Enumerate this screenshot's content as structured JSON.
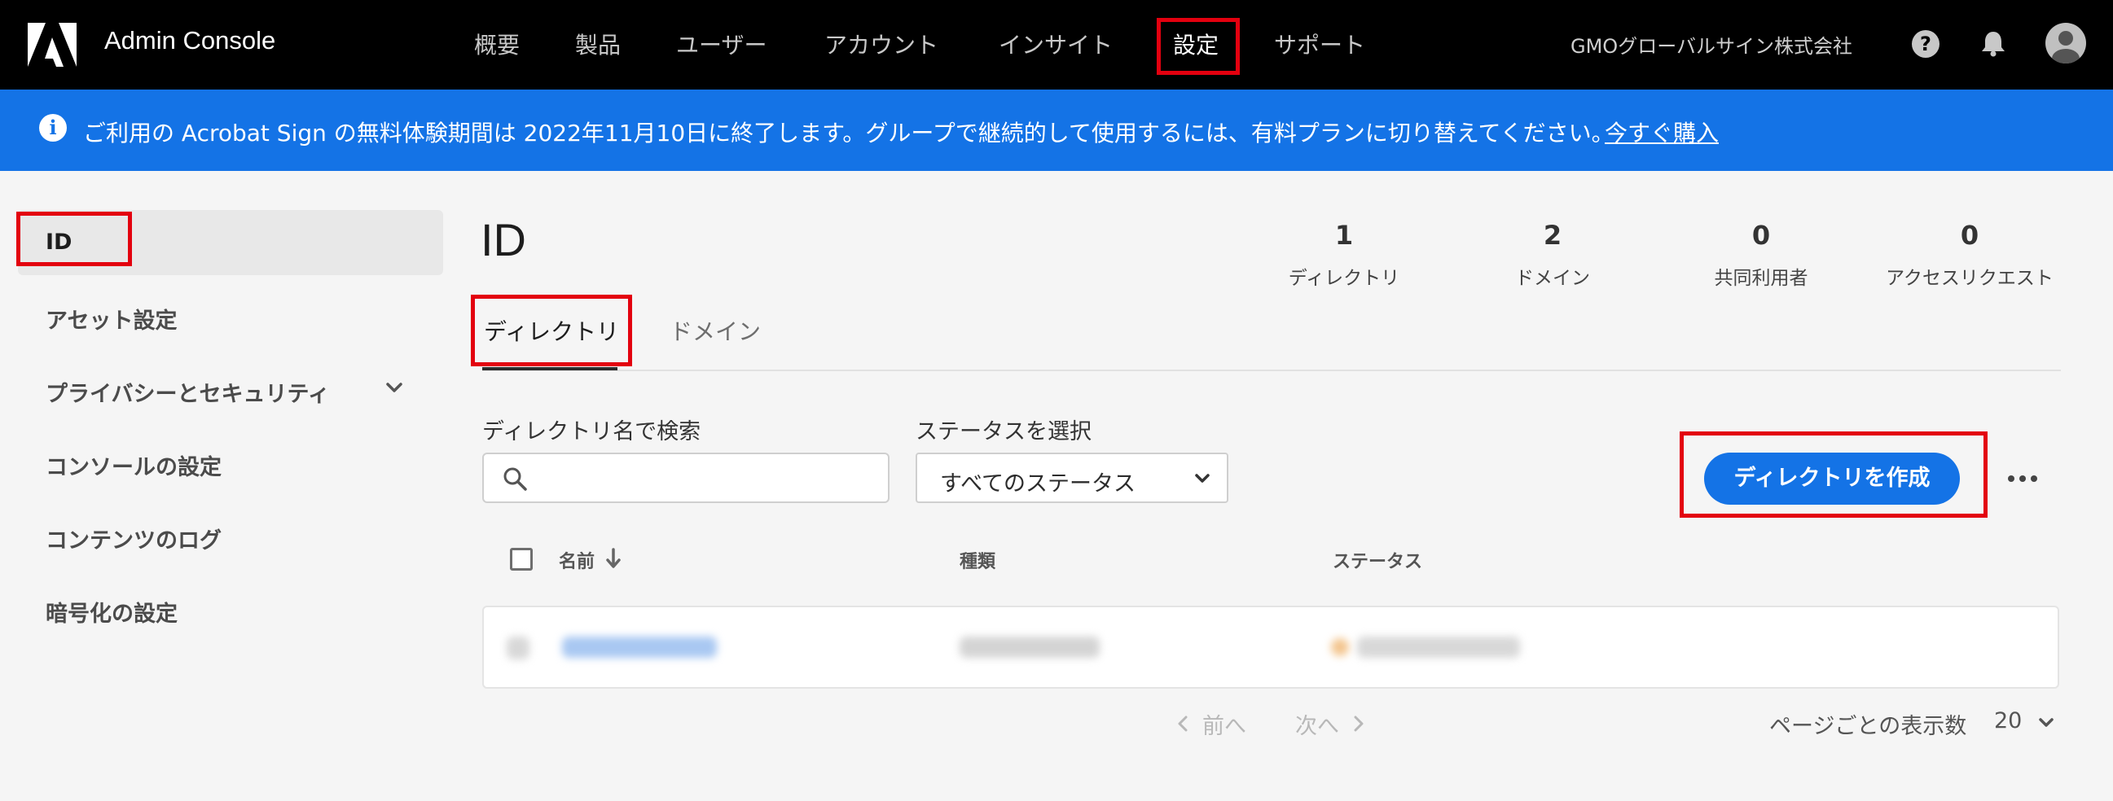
{
  "header": {
    "app_title": "Admin Console",
    "nav": [
      "概要",
      "製品",
      "ユーザー",
      "アカウント",
      "インサイト",
      "設定",
      "サポート"
    ],
    "active_nav": "設定",
    "org_name": "GMOグローバルサイン株式会社",
    "help_glyph": "?"
  },
  "banner": {
    "info_glyph": "i",
    "message": "ご利用の Acrobat Sign の無料体験期間は 2022年11月10日に終了します。グループで継続的して使用するには、有料プランに切り替えてください。",
    "link": "今すぐ購入"
  },
  "sidebar": {
    "items": [
      "ID",
      "アセット設定",
      "プライバシーとセキュリティ",
      "コンソールの設定",
      "コンテンツのログ",
      "暗号化の設定"
    ],
    "active": "ID"
  },
  "main": {
    "title": "ID",
    "stats": [
      {
        "value": "1",
        "label": "ディレクトリ"
      },
      {
        "value": "2",
        "label": "ドメイン"
      },
      {
        "value": "0",
        "label": "共同利用者"
      },
      {
        "value": "0",
        "label": "アクセスリクエスト"
      }
    ],
    "tabs": [
      "ディレクトリ",
      "ドメイン"
    ],
    "active_tab": "ディレクトリ",
    "search": {
      "label": "ディレクトリ名で検索",
      "value": "",
      "placeholder": ""
    },
    "status_select": {
      "label": "ステータスを選択",
      "value": "すべてのステータス"
    },
    "create_button": "ディレクトリを作成",
    "table": {
      "columns": [
        "名前",
        "種類",
        "ステータス"
      ]
    },
    "pagination": {
      "prev": "前へ",
      "next": "次へ",
      "per_page_label": "ページごとの表示数",
      "per_page_value": "20"
    }
  },
  "colors": {
    "accent": "#1473e6",
    "highlight": "#e3000f",
    "topbar": "#000000"
  }
}
